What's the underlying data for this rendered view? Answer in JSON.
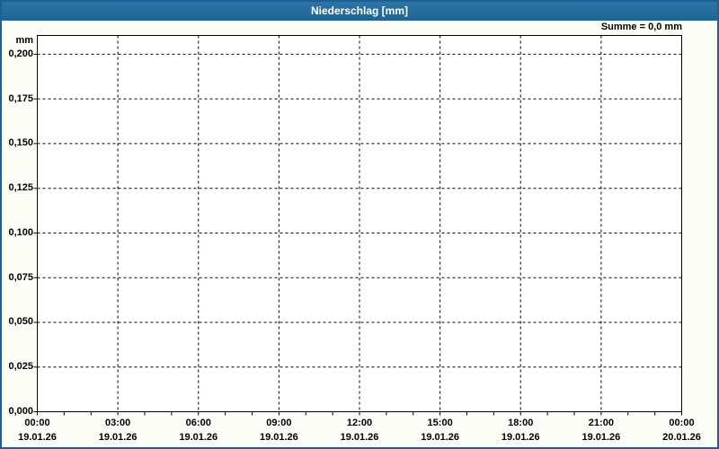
{
  "header": {
    "title": "Niederschlag [mm]",
    "summary": "Summe = 0,0 mm"
  },
  "chart_data": {
    "type": "line",
    "title": "Niederschlag [mm]",
    "subtitle": "",
    "ylabel": "mm",
    "xlabel": "",
    "annotation": "Summe = 0,0 mm",
    "grid": {
      "style": "dashed",
      "color": "#000000",
      "visible": true
    },
    "legend_position": "none",
    "x_axis": {
      "range_hours": [
        0,
        24
      ],
      "minor_tick_every_hours": 1,
      "major_tick_every_hours": 3,
      "major_ticks": [
        {
          "time": "00:00",
          "date": "19.01.26"
        },
        {
          "time": "03:00",
          "date": "19.01.26"
        },
        {
          "time": "06:00",
          "date": "19.01.26"
        },
        {
          "time": "09:00",
          "date": "19.01.26"
        },
        {
          "time": "12:00",
          "date": "19.01.26"
        },
        {
          "time": "15:00",
          "date": "19.01.26"
        },
        {
          "time": "18:00",
          "date": "19.01.26"
        },
        {
          "time": "21:00",
          "date": "19.01.26"
        },
        {
          "time": "00:00",
          "date": "20.01.26"
        }
      ]
    },
    "y_axis": {
      "unit": "mm",
      "ylim": [
        0,
        0.2105
      ],
      "tick_step": 0.025,
      "tick_values": [
        0.0,
        0.025,
        0.05,
        0.075,
        0.1,
        0.125,
        0.15,
        0.175,
        0.2
      ],
      "tick_labels": [
        "0,000",
        "0,025",
        "0,050",
        "0,075",
        "0,100",
        "0,125",
        "0,150",
        "0,175",
        "0,200"
      ]
    },
    "series": [
      {
        "name": "Niederschlag",
        "sum_mm": "0,0",
        "values": []
      }
    ]
  },
  "colors": {
    "title_bar": "#1d6a9e",
    "window_border": "#1d5e94",
    "background": "#fcfdf6",
    "plot_background": "#ffffff",
    "grid": "#000000",
    "title_text": "#ffffff",
    "label_text": "#000000"
  }
}
